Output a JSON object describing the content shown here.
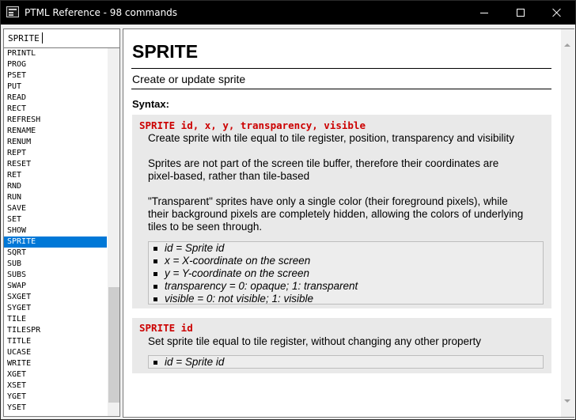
{
  "window": {
    "title": "PTML Reference - 98 commands"
  },
  "search": {
    "value": "SPRITE"
  },
  "commands": [
    "PRINTL",
    "PROG",
    "PSET",
    "PUT",
    "READ",
    "RECT",
    "REFRESH",
    "RENAME",
    "RENUM",
    "REPT",
    "RESET",
    "RET",
    "RND",
    "RUN",
    "SAVE",
    "SET",
    "SHOW",
    "SPRITE",
    "SQRT",
    "SUB",
    "SUBS",
    "SWAP",
    "SXGET",
    "SYGET",
    "TILE",
    "TILESPR",
    "TITLE",
    "UCASE",
    "WRITE",
    "XGET",
    "XSET",
    "YGET",
    "YSET"
  ],
  "selected_command": "SPRITE",
  "doc": {
    "title": "SPRITE",
    "summary": "Create or update sprite",
    "syntax_heading": "Syntax:",
    "blocks": [
      {
        "code": "SPRITE id, x, y, transparency, visible",
        "desc": [
          "Create sprite with tile equal to tile register, position, transparency and visibility",
          "Sprites are not part of the screen tile buffer, therefore their coordinates are\npixel-based, rather than tile-based",
          "\"Transparent\" sprites have only a single color (their foreground pixels), while\ntheir background pixels are completely hidden, allowing the colors of underlying\ntiles to be seen through."
        ],
        "params": [
          "id = Sprite id",
          "x = X-coordinate on the screen",
          "y = Y-coordinate on the screen",
          "transparency = 0: opaque; 1: transparent",
          "visible = 0: not visible; 1: visible"
        ]
      },
      {
        "code": "SPRITE id",
        "desc": [
          "Set sprite tile equal to tile register, without changing any other property"
        ],
        "params": [
          "id = Sprite id"
        ]
      }
    ]
  },
  "colors": {
    "selection": "#0078d7",
    "code": "#cc0000",
    "block_bg": "#e9e9e9"
  }
}
